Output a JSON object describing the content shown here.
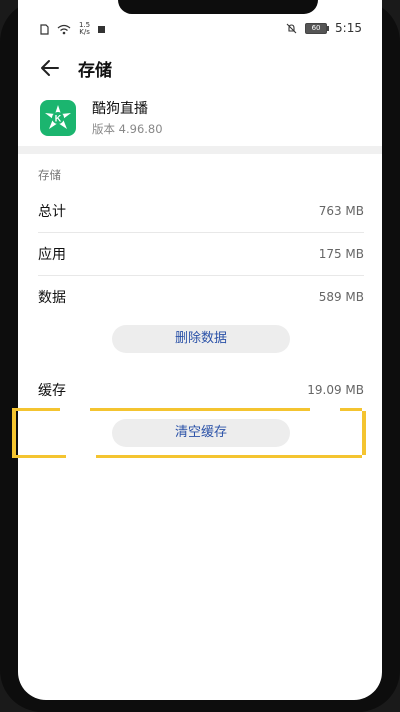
{
  "status_bar": {
    "speed_value": "1.5",
    "speed_unit": "K/s",
    "time": "5:15",
    "battery": "60"
  },
  "header": {
    "title": "存储"
  },
  "app": {
    "name": "酷狗直播",
    "version": "版本 4.96.80",
    "icon": "kugou-live-app-icon"
  },
  "storage": {
    "section_label": "存储",
    "rows": [
      {
        "label": "总计",
        "value": "763 MB"
      },
      {
        "label": "应用",
        "value": "175 MB"
      },
      {
        "label": "数据",
        "value": "589 MB"
      }
    ],
    "delete_data_label": "删除数据"
  },
  "cache": {
    "label": "缓存",
    "value": "19.09 MB",
    "clear_cache_label": "清空缓存"
  },
  "colors": {
    "accent": "#2b52a8",
    "highlight": "#f4c430",
    "app_icon": "#1bb56f"
  }
}
